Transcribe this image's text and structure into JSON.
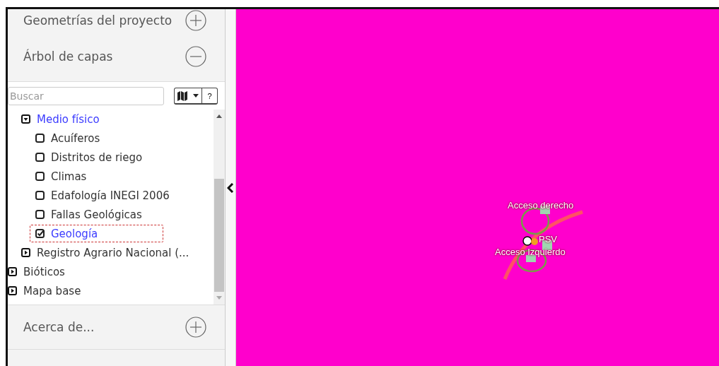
{
  "accordion_top": [
    {
      "title": "Geometrías del proyecto",
      "expanded": false
    },
    {
      "title": "Árbol de capas",
      "expanded": true
    }
  ],
  "search": {
    "placeholder": "Buscar"
  },
  "toolbar": {
    "help": "?"
  },
  "tree": {
    "subtree": [
      {
        "label": "Medio físico",
        "expanded": true,
        "highlighted": true,
        "children": [
          {
            "label": "Acuíferos",
            "checked": false,
            "selected": false
          },
          {
            "label": "Distritos de riego",
            "checked": false,
            "selected": false
          },
          {
            "label": "Climas",
            "checked": false,
            "selected": false
          },
          {
            "label": "Edafología INEGI 2006",
            "checked": false,
            "selected": false
          },
          {
            "label": "Fallas Geológicas",
            "checked": false,
            "selected": false
          },
          {
            "label": "Geología",
            "checked": true,
            "selected": true
          }
        ]
      },
      {
        "label": "Registro Agrario Nacional (...",
        "expanded": false,
        "highlighted": false
      }
    ],
    "top_level": [
      {
        "label": "Bióticos",
        "expanded": false
      },
      {
        "label": "Mapa base",
        "expanded": false
      }
    ]
  },
  "accordion_bottom": [
    {
      "title": "Acerca de...",
      "expanded": false
    }
  ],
  "map": {
    "labels": [
      {
        "text": "Acceso derecho"
      },
      {
        "text": "PSV"
      },
      {
        "text": "Acceso Izquierdo"
      }
    ]
  }
}
